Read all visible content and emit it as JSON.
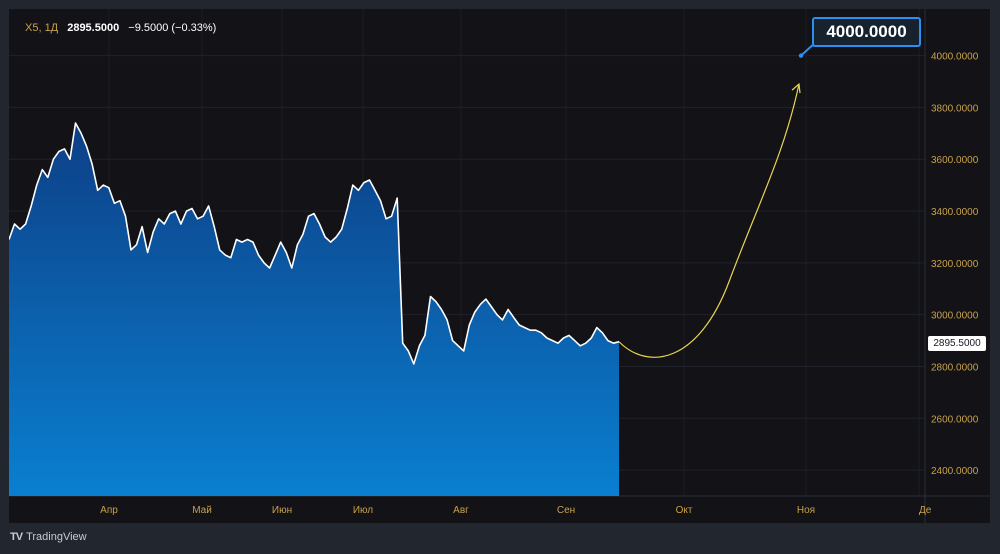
{
  "legend": {
    "symbol": "X5, 1Д",
    "last": "2895.5000",
    "change": "−9.5000 (−0.33%)"
  },
  "price_tag": "2895.5000",
  "callout": "4000.0000",
  "brand": "TradingView",
  "colors": {
    "pane": "#121217",
    "frame": "#22262f",
    "line": "#ffffff",
    "area_top": "#0d3f86",
    "area_bottom": "#0a7fd0",
    "axis_text": "#c9a24a",
    "arrow": "#e8d651",
    "callout_border": "#2a8ef2"
  },
  "chart_data": {
    "type": "area",
    "x_axis": {
      "labels": [
        "Апр",
        "Май",
        "Июн",
        "Июл",
        "Авг",
        "Сен",
        "Окт",
        "Ноя",
        "Де"
      ]
    },
    "y_axis": {
      "ticks": [
        4000,
        3800,
        3600,
        3400,
        3200,
        3000,
        2800,
        2600,
        2400
      ],
      "range": [
        2300,
        4180
      ],
      "position": "right"
    },
    "grid": true,
    "series": [
      {
        "values": [
          3290,
          3350,
          3330,
          3350,
          3420,
          3500,
          3560,
          3530,
          3600,
          3630,
          3640,
          3600,
          3740,
          3700,
          3650,
          3580,
          3480,
          3500,
          3490,
          3430,
          3440,
          3380,
          3250,
          3270,
          3340,
          3240,
          3320,
          3370,
          3350,
          3390,
          3400,
          3350,
          3400,
          3410,
          3370,
          3380,
          3420,
          3340,
          3250,
          3230,
          3220,
          3290,
          3280,
          3290,
          3280,
          3230,
          3200,
          3180,
          3230,
          3280,
          3240,
          3180,
          3270,
          3310,
          3380,
          3390,
          3350,
          3300,
          3280,
          3300,
          3330,
          3410,
          3500,
          3480,
          3510,
          3520,
          3480,
          3440,
          3370,
          3380,
          3450,
          2890,
          2860,
          2810,
          2880,
          2920,
          3070,
          3050,
          3020,
          2980,
          2900,
          2880,
          2860,
          2960,
          3010,
          3040,
          3060,
          3030,
          3000,
          2980,
          3020,
          2990,
          2960,
          2950,
          2940,
          2940,
          2930,
          2910,
          2900,
          2890,
          2910,
          2920,
          2900,
          2880,
          2890,
          2910,
          2950,
          2930,
          2900,
          2890,
          2895.5
        ]
      }
    ],
    "annotations": [
      {
        "type": "projection-arrow",
        "start_value": 2895.5,
        "end_value": 3890,
        "label": "4000.0000",
        "label_value": 4000
      }
    ]
  }
}
